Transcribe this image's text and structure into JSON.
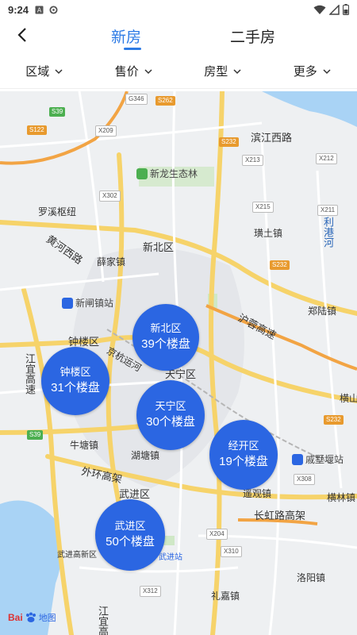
{
  "status": {
    "time": "9:24"
  },
  "header": {
    "tabs": [
      {
        "label": "新房",
        "active": true
      },
      {
        "label": "二手房",
        "active": false
      }
    ]
  },
  "filters": [
    {
      "label": "区域"
    },
    {
      "label": "售价"
    },
    {
      "label": "房型"
    },
    {
      "label": "更多"
    }
  ],
  "map": {
    "places": {
      "xinlong": "新龙生态林",
      "luoxi": "罗溪枢纽",
      "yellowriver": "黄河西路",
      "xinbei": "新北区",
      "xuejia": "薛家镇",
      "xinzha": "新闸镇站",
      "zhonglou_label": "钟楼区",
      "jinghang": "京杭运河",
      "tianning_label": "天宁区",
      "jiangyi": "江宜高速",
      "niutang": "牛塘镇",
      "hutang": "湖塘镇",
      "waihuan": "外环高架",
      "wujin_label": "武进区",
      "wujingaoxin": "武进高新区",
      "lijia": "礼嘉镇",
      "binjiang": "滨江西路",
      "kuibei": "璜土镇",
      "ligang": "利港河",
      "zhengl": "郑陆镇",
      "huning": "沪蓉高速",
      "hengshan": "横山",
      "qishuyan": "戚墅堰站",
      "yaoguan": "遥观镇",
      "henglin": "横林镇",
      "changhong": "长虹路高架",
      "luoyang": "洛阳镇",
      "jiangyi2": "江宜高速",
      "tiandi": "天宁区站",
      "wujin_station": "武进站"
    },
    "shields": {
      "g346": "G346",
      "s262": "S262",
      "s39a": "S39",
      "s122": "S122",
      "x209": "X209",
      "s232": "S232",
      "x213": "X213",
      "x212": "X212",
      "x302": "X302",
      "x215": "X215",
      "x211": "X211",
      "s232b": "S232",
      "s232c": "S232",
      "s39b": "S39",
      "x308": "X308",
      "x204": "X204",
      "x310": "X310",
      "x312": "X312"
    }
  },
  "bubbles": [
    {
      "name": "新北区",
      "count": "39个楼盘"
    },
    {
      "name": "钟楼区",
      "count": "31个楼盘"
    },
    {
      "name": "天宁区",
      "count": "30个楼盘"
    },
    {
      "name": "经开区",
      "count": "19个楼盘"
    },
    {
      "name": "武进区",
      "count": "50个楼盘"
    }
  ],
  "logo": {
    "brand": "Bai",
    "suffix": "地图"
  },
  "colors": {
    "accent": "#2d7be5",
    "bubble": "#2b66e2"
  }
}
